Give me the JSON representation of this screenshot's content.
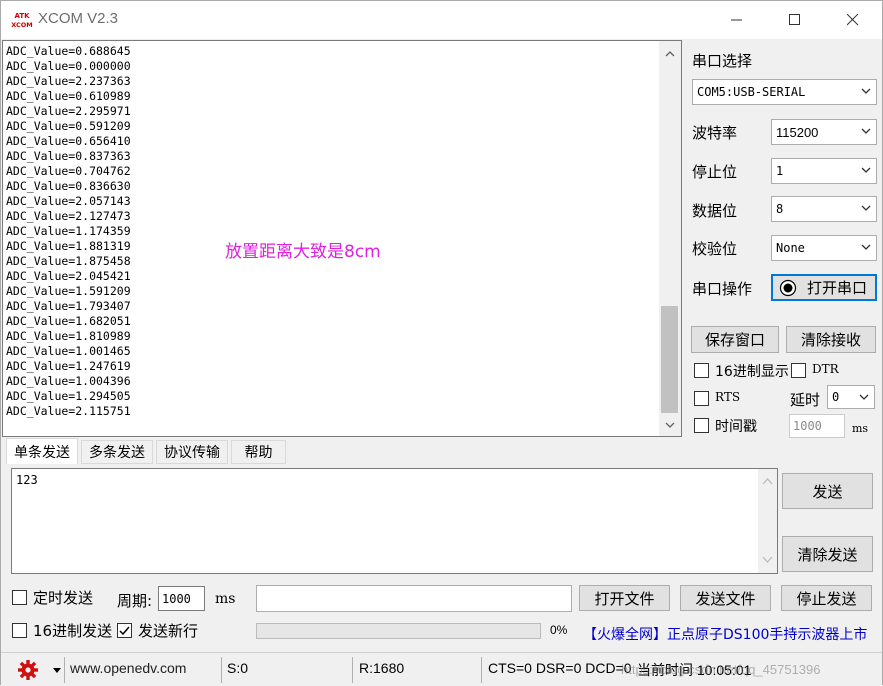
{
  "window": {
    "title": "XCOM V2.3",
    "logo_text": "ATK XCOM"
  },
  "receive": {
    "lines": [
      "ADC_Value=0.688645",
      "ADC_Value=0.000000",
      "ADC_Value=2.237363",
      "ADC_Value=0.610989",
      "ADC_Value=2.295971",
      "ADC_Value=0.591209",
      "ADC_Value=0.656410",
      "ADC_Value=0.837363",
      "ADC_Value=0.704762",
      "ADC_Value=0.836630",
      "ADC_Value=2.057143",
      "ADC_Value=2.127473",
      "ADC_Value=1.174359",
      "ADC_Value=1.881319",
      "ADC_Value=1.875458",
      "ADC_Value=2.045421",
      "ADC_Value=1.591209",
      "ADC_Value=1.793407",
      "ADC_Value=1.682051",
      "ADC_Value=1.810989",
      "ADC_Value=1.001465",
      "ADC_Value=1.247619",
      "ADC_Value=1.004396",
      "ADC_Value=1.294505",
      "ADC_Value=2.115751"
    ],
    "annotation": "放置距离大致是8cm"
  },
  "settings": {
    "port_select_label": "串口选择",
    "port_value": "COM5:USB-SERIAL",
    "baud_label": "波特率",
    "baud_value": "115200",
    "stopbits_label": "停止位",
    "stopbits_value": "1",
    "databits_label": "数据位",
    "databits_value": "8",
    "parity_label": "校验位",
    "parity_value": "None",
    "port_op_label": "串口操作",
    "open_port_button": "打开串口",
    "save_window_button": "保存窗口",
    "clear_recv_button": "清除接收",
    "hex_display_label": "16进制显示",
    "dtr_label": "DTR",
    "rts_label": "RTS",
    "delay_label": "延时",
    "delay_value": "0",
    "timestamp_label": "时间戳",
    "timestamp_value": "1000",
    "timestamp_unit": "ms"
  },
  "tabs": [
    "单条发送",
    "多条发送",
    "协议传输",
    "帮助"
  ],
  "send": {
    "text": "123",
    "send_button": "发送",
    "clear_send_button": "清除发送",
    "timed_send_label": "定时发送",
    "period_label": "周期:",
    "period_value": "1000",
    "period_unit": "ms",
    "open_file_button": "打开文件",
    "send_file_button": "发送文件",
    "stop_send_button": "停止发送",
    "hex_send_label": "16进制发送",
    "send_newline_label": "发送新行",
    "send_newline_checked": true,
    "progress_text": "0%",
    "progress": 0,
    "promo_text": "【火爆全网】正点原子DS100手持示波器上市"
  },
  "status": {
    "website": "www.openedv.com",
    "sent": "S:0",
    "received": "R:1680",
    "signals": "CTS=0 DSR=0 DCD=0",
    "time": "当前时间 10:05:01",
    "watermark": "https://blog.csdn.net/qq_45751396"
  },
  "colors": {
    "annotation": "#e020e0",
    "promo": "#0000cc",
    "focus": "#0078d7"
  }
}
